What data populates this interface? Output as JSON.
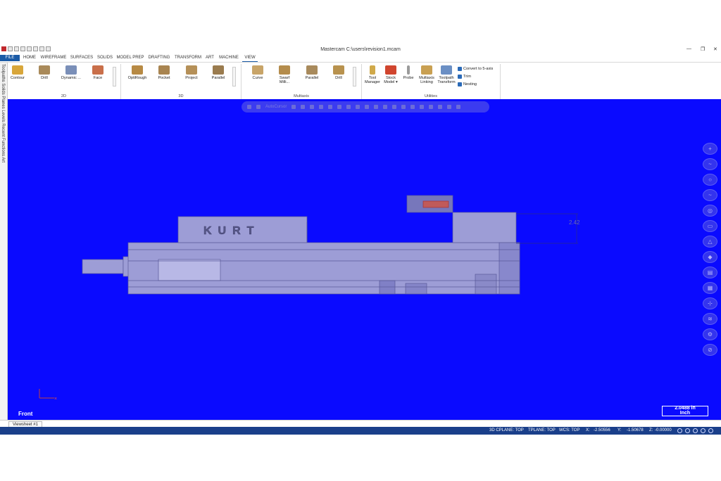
{
  "window": {
    "title": "Mastercam C:\\users\\revision1.mcam"
  },
  "menu": {
    "tabs": [
      "FILE",
      "HOME",
      "WIREFRAME",
      "SURFACES",
      "SOLIDS",
      "MODEL PREP",
      "DRAFTING",
      "TRANSFORM",
      "ART",
      "MACHINE",
      "VIEW"
    ]
  },
  "ribbon": {
    "group_2d": {
      "name": "2D",
      "buttons": [
        "Contour",
        "Drill",
        "Dynamic ...",
        "Face"
      ]
    },
    "group_3d": {
      "name": "3D",
      "buttons": [
        "OptiRough",
        "Pocket",
        "Project",
        "Parallel"
      ]
    },
    "group_multiaxis": {
      "name": "Multiaxis",
      "buttons": [
        "Curve",
        "Swarf Milli...",
        "Parallel",
        "Drill"
      ]
    },
    "group_utilities": {
      "name": "Utilities",
      "buttons": [
        [
          "Tool",
          "Manager"
        ],
        [
          "Stock",
          "Model ▾"
        ],
        [
          "Probe",
          ""
        ],
        [
          "Multiaxis",
          "Linking"
        ],
        [
          "Toolpath",
          "Transform"
        ]
      ],
      "small": [
        "Convert to 5-axis",
        "Trim",
        "Nesting"
      ]
    }
  },
  "manager_tabs": "Toolpaths  Solids  Planes  Levels  Recent Functions  Art",
  "viewport": {
    "floating_toolbar": {
      "autocursor": "AutoCursor"
    },
    "part_label": "KURT",
    "dimension": "2.42",
    "view_name": "Front",
    "scale": {
      "value": "2.0488 in",
      "unit": "Inch"
    },
    "right_nav_icons": [
      "+",
      "~",
      "○",
      "~",
      "◎",
      "▭",
      "△",
      "◆",
      "▤",
      "▦",
      "⊹",
      "≋",
      "⚙",
      "⊘"
    ]
  },
  "sheet_tab": "Viewsheet #1",
  "status": {
    "cplane": "3D CPLANE: TOP",
    "tplane": "TPLANE: TOP",
    "wcs": "WCS: TOP",
    "x_label": "X:",
    "x": "-2.50556",
    "y_label": "Y:",
    "y": "-1.50678",
    "z_label": "Z:",
    "z": "-0.00000"
  },
  "colors": {
    "viewport": "#0a0aff",
    "status": "#1a3f8a",
    "file_tab": "#1a5aa6",
    "part": "#9d9dd6"
  }
}
